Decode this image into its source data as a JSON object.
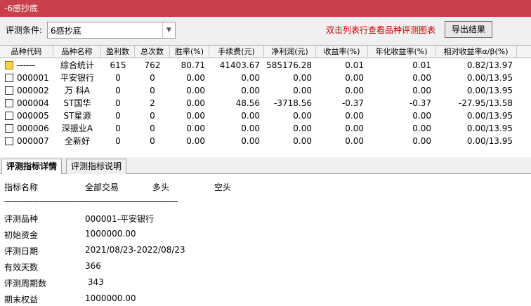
{
  "window": {
    "title": "-6感抄底"
  },
  "condition": {
    "label": "评测条件:",
    "selected": "6感抄底",
    "hint": "双击列表行查看品种评测图表",
    "export_label": "导出结果"
  },
  "table": {
    "columns": [
      "品种代码",
      "品种名称",
      "盈利数",
      "总次数",
      "胜率(%)",
      "手续费(元)",
      "净利润(元)",
      "收益率(%)",
      "年化收益率(%)",
      "相对收益率α/β(%)"
    ],
    "rows": [
      {
        "code": "------",
        "name": "综合统计",
        "profit_count": "615",
        "total_count": "762",
        "win_rate": "80.71",
        "fee": "41403.67",
        "net_profit": "585176.28",
        "return": "0.01",
        "annual_return": "0.01",
        "relative_return": "0.82/13.97",
        "icon": "summary-icon"
      },
      {
        "code": "000001",
        "name": "平安银行",
        "profit_count": "0",
        "total_count": "0",
        "win_rate": "0.00",
        "fee": "0.00",
        "net_profit": "0.00",
        "return": "0.00",
        "annual_return": "0.00",
        "relative_return": "0.00/13.95",
        "icon": "stock-icon"
      },
      {
        "code": "000002",
        "name": "万 科A",
        "profit_count": "0",
        "total_count": "0",
        "win_rate": "0.00",
        "fee": "0.00",
        "net_profit": "0.00",
        "return": "0.00",
        "annual_return": "0.00",
        "relative_return": "0.00/13.95",
        "icon": "stock-icon"
      },
      {
        "code": "000004",
        "name": "ST国华",
        "profit_count": "0",
        "total_count": "2",
        "win_rate": "0.00",
        "fee": "48.56",
        "net_profit": "-3718.56",
        "return": "-0.37",
        "annual_return": "-0.37",
        "relative_return": "-27.95/13.58",
        "icon": "stock-icon"
      },
      {
        "code": "000005",
        "name": "ST星源",
        "profit_count": "0",
        "total_count": "0",
        "win_rate": "0.00",
        "fee": "0.00",
        "net_profit": "0.00",
        "return": "0.00",
        "annual_return": "0.00",
        "relative_return": "0.00/13.95",
        "icon": "stock-icon"
      },
      {
        "code": "000006",
        "name": "深振业A",
        "profit_count": "0",
        "total_count": "0",
        "win_rate": "0.00",
        "fee": "0.00",
        "net_profit": "0.00",
        "return": "0.00",
        "annual_return": "0.00",
        "relative_return": "0.00/13.95",
        "icon": "stock-icon"
      },
      {
        "code": "000007",
        "name": "全新好",
        "profit_count": "0",
        "total_count": "0",
        "win_rate": "0.00",
        "fee": "0.00",
        "net_profit": "0.00",
        "return": "0.00",
        "annual_return": "0.00",
        "relative_return": "0.00/13.95",
        "icon": "stock-icon"
      }
    ]
  },
  "tabs": [
    {
      "label": "评测指标详情",
      "active": true
    },
    {
      "label": "评测指标说明",
      "active": false
    }
  ],
  "detail": {
    "header": {
      "name": "指标名称",
      "all": "全部交易",
      "long": "多头",
      "short": "空头"
    },
    "separator": "--------------------------------------------------------------------------",
    "items": [
      {
        "label": "评测品种",
        "value": "000001-平安银行"
      },
      {
        "label": "初始资金",
        "value": "1000000.00"
      },
      {
        "label": "评测日期",
        "value": "2021/08/23-2022/08/23"
      },
      {
        "label": "有效天数",
        "value": "366"
      },
      {
        "label": "评测周期数",
        "value": " 343"
      },
      {
        "label": "期末权益",
        "value": "1000000.00"
      }
    ]
  }
}
